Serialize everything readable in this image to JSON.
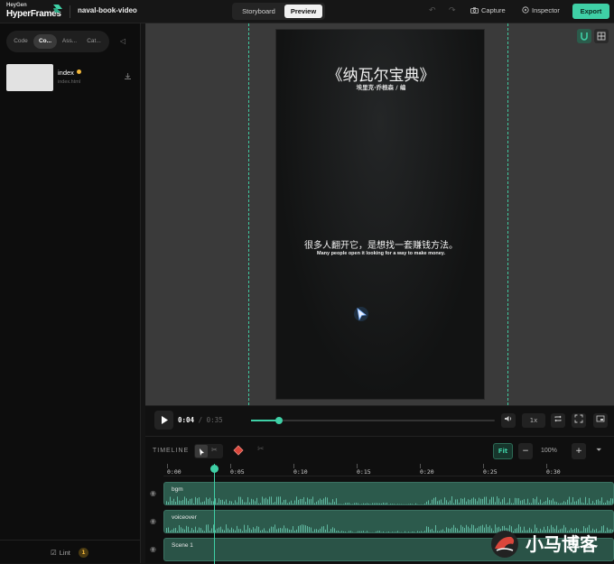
{
  "header": {
    "brand_top": "HeyGen",
    "brand_main": "HyperFrames",
    "project_name": "naval-book-video",
    "tabs": [
      {
        "label": "Storyboard"
      },
      {
        "label": "Preview"
      }
    ],
    "capture_label": "Capture",
    "inspector_label": "Inspector",
    "export_label": "Export"
  },
  "sidebar": {
    "tabs": [
      {
        "label": "Code"
      },
      {
        "label": "Co..."
      },
      {
        "label": "Ass..."
      },
      {
        "label": "Cat..."
      }
    ],
    "file": {
      "name": "index",
      "path": "index.html"
    },
    "lint_label": "Lint",
    "lint_count": "1"
  },
  "preview": {
    "title": "《纳瓦尔宝典》",
    "author": "埃里克·乔根森 / 编",
    "subtitle_cn": "很多人翻开它，是想找一套赚钱方法。",
    "subtitle_en": "Many people open it looking for a way to make money."
  },
  "player": {
    "current_time": "0:04",
    "total_time": "/ 0:35",
    "progress": 0.114,
    "speed": "1x"
  },
  "timeline": {
    "label": "TIMELINE",
    "fit_label": "Fit",
    "zoom_label": "100%",
    "ticks": [
      "0:00",
      "0:05",
      "0:10",
      "0:15",
      "0:20",
      "0:25",
      "0:30"
    ],
    "tracks": [
      {
        "name": "bgm"
      },
      {
        "name": "voiceover"
      },
      {
        "name": "Scene 1"
      }
    ]
  },
  "watermark": "小马博客",
  "colors": {
    "accent": "#3fd0a6",
    "clip": "#2c5a4c",
    "warning": "#f2b73a"
  }
}
